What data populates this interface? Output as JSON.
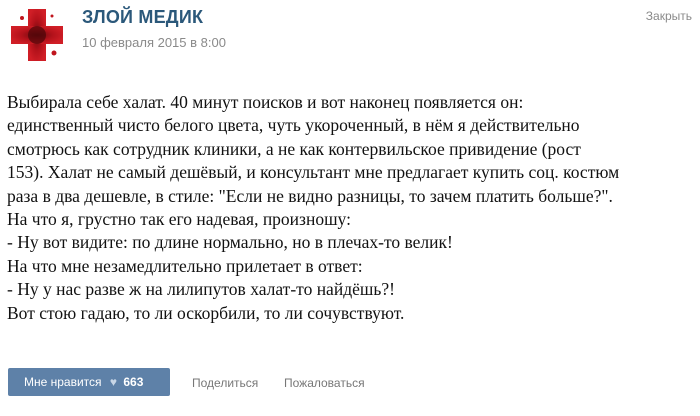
{
  "post": {
    "author": "ЗЛОЙ МЕДИК",
    "date": "10 февраля 2015 в 8:00",
    "close_label": "Закрыть",
    "lines": [
      "Выбирала себе халат. 40 минут поисков и вот наконец появляется он:",
      "единственный чисто белого цвета, чуть укороченный, в нём я действительно",
      "смотрюсь как сотрудник клиники, а не как контервильское привидение (рост",
      "153). Халат не самый дешёвый, и консультант мне предлагает купить соц. костюм",
      "раза в два дешевле, в стиле: \"Если не видно разницы, то зачем платить больше?\".",
      "На что я, грустно так его надевая, произношу:",
      "- Ну вот видите: по длине нормально, но в плечах-то велик!",
      "На что мне незамедлительно прилетает в ответ:",
      "- Ну у нас разве ж на лилипутов халат-то найдёшь?!",
      "Вот стою гадаю, то ли оскорбили, то ли сочувствуют."
    ]
  },
  "actions": {
    "like_label": "Мне нравится",
    "like_icon": "heart-icon",
    "like_count": "663",
    "share_label": "Поделиться",
    "report_label": "Пожаловаться"
  },
  "colors": {
    "author": "#2b587a",
    "like_button": "#5e81a8",
    "avatar_red": "#b4121b"
  }
}
